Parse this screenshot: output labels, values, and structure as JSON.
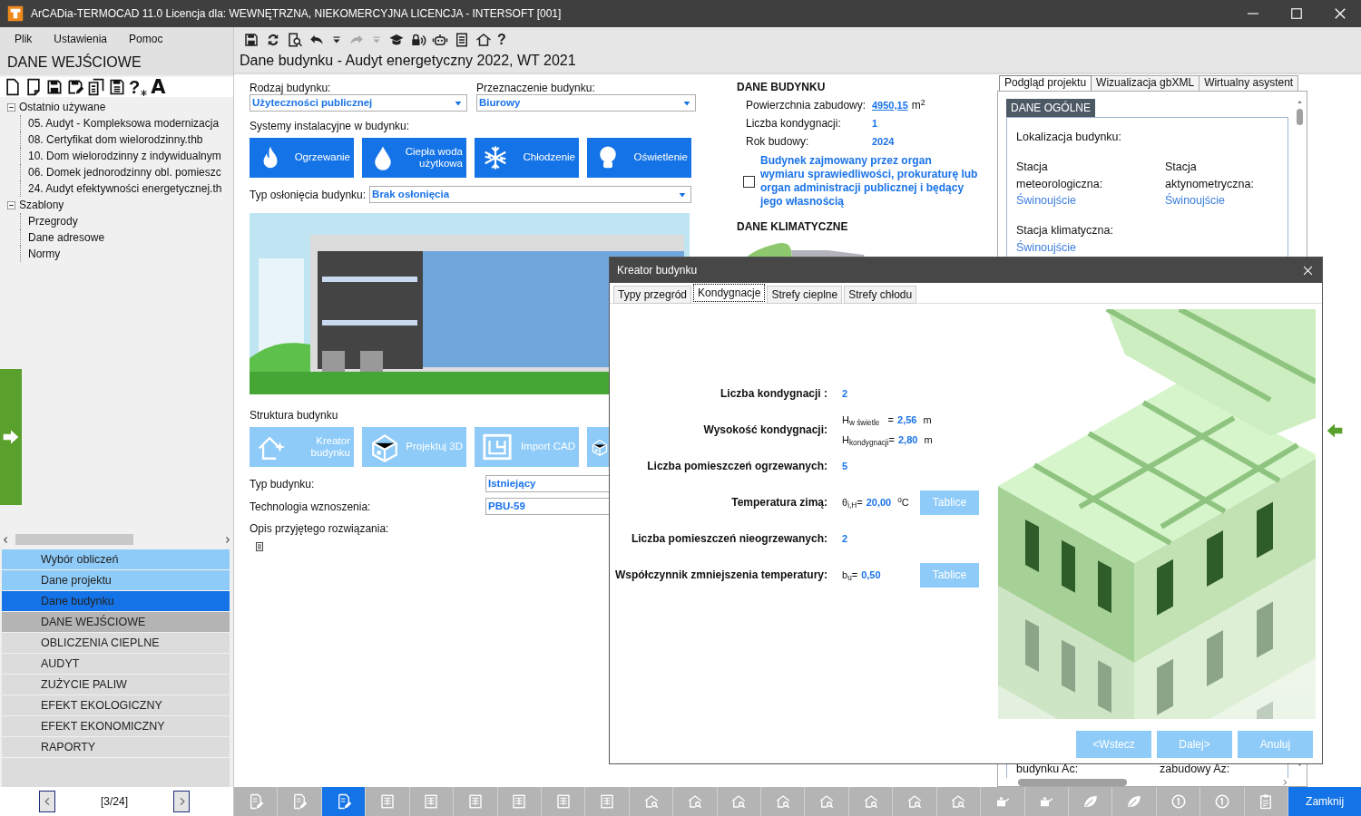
{
  "window": {
    "title": "ArCADia-TERMOCAD 11.0 Licencja dla: WEWNĘTRZNA, NIEKOMERCYJNA LICENCJA - INTERSOFT [001]"
  },
  "menu": [
    {
      "label": "Plik"
    },
    {
      "label": "Ustawienia"
    },
    {
      "label": "Pomoc"
    }
  ],
  "toolbar": [
    {
      "kind": "save",
      "disabled": false
    },
    {
      "kind": "sync",
      "disabled": false
    },
    {
      "kind": "preview",
      "disabled": false
    },
    {
      "kind": "undo",
      "disabled": false
    },
    {
      "kind": "menu-arrow",
      "disabled": false
    },
    {
      "kind": "redo",
      "disabled": true
    },
    {
      "kind": "menu-arrow",
      "disabled": true
    },
    {
      "kind": "cap",
      "disabled": false
    },
    {
      "kind": "lock",
      "disabled": false
    },
    {
      "kind": "robot",
      "disabled": false
    },
    {
      "kind": "notes",
      "disabled": false
    },
    {
      "kind": "house",
      "disabled": false
    },
    {
      "kind": "help",
      "glyph": "?",
      "disabled": false
    }
  ],
  "left_panel": {
    "title": "DANE WEJŚCIOWE",
    "toolbar": [
      {
        "kind": "new-doc"
      },
      {
        "kind": "new-doc-corner"
      },
      {
        "kind": "save"
      },
      {
        "kind": "save-edit"
      },
      {
        "kind": "copy-doc"
      },
      {
        "kind": "save-list"
      },
      {
        "kind": "help-star",
        "glyph": "?"
      },
      {
        "kind": "font",
        "glyph": "A"
      }
    ],
    "tree": [
      {
        "label": "Ostatnio używane",
        "expanded": true,
        "children": [
          {
            "label": "05. Audyt - Kompleksowa modernizacja"
          },
          {
            "label": "08. Certyfikat dom wielorodzinny.thb"
          },
          {
            "label": "10. Dom wielorodzinny z indywidualnym"
          },
          {
            "label": "06. Domek jednorodzinny obl. pomieszc"
          },
          {
            "label": "24. Audyt efektywności energetycznej.th"
          }
        ]
      },
      {
        "label": "Szablony",
        "expanded": true,
        "children": [
          {
            "label": "Przegrody"
          },
          {
            "label": "Dane adresowe"
          },
          {
            "label": "Normy"
          }
        ]
      }
    ],
    "nav": [
      {
        "label": "Wybór obliczeń",
        "kind": "step",
        "selected": false
      },
      {
        "label": "Dane projektu",
        "kind": "step",
        "selected": false
      },
      {
        "label": "Dane budynku",
        "kind": "step",
        "selected": true
      },
      {
        "label": "DANE WEJŚCIOWE",
        "kind": "section",
        "selected": true
      },
      {
        "label": "OBLICZENIA CIEPLNE",
        "kind": "section",
        "selected": false
      },
      {
        "label": "AUDYT",
        "kind": "section",
        "selected": false
      },
      {
        "label": "ZUŻYCIE PALIW",
        "kind": "section",
        "selected": false
      },
      {
        "label": "EFEKT EKOLOGICZNY",
        "kind": "section",
        "selected": false
      },
      {
        "label": "EFEKT EKONOMICZNY",
        "kind": "section",
        "selected": false
      },
      {
        "label": "RAPORTY",
        "kind": "section",
        "selected": false
      }
    ],
    "pager": "[3/24]"
  },
  "main": {
    "title": "Dane budynku - Audyt energetyczny 2022, WT 2021",
    "building_type": {
      "label": "Rodzaj budynku:",
      "value": "Użyteczności publicznej"
    },
    "purpose": {
      "label": "Przeznaczenie budynku:",
      "value": "Biurowy"
    },
    "systems_label": "Systemy instalacyjne w budynku:",
    "systems": [
      {
        "label": "Ogrzewanie",
        "kind": "flame"
      },
      {
        "label": "Ciepła woda użytkowa",
        "kind": "drop"
      },
      {
        "label": "Chłodzenie",
        "kind": "snow"
      },
      {
        "label": "Oświetlenie",
        "kind": "bulb"
      }
    ],
    "shading": {
      "label": "Typ osłonięcia budynku:",
      "value": "Brak osłonięcia"
    },
    "structure_label": "Struktura budynku",
    "structure_buttons": [
      {
        "label": "Kreator budynku",
        "kind": "wizard"
      },
      {
        "label": "Projektuj 3D",
        "kind": "house3d"
      },
      {
        "label": "Import CAD",
        "kind": "plan"
      },
      {
        "kind": "house3d"
      }
    ],
    "building_kind": {
      "label": "Typ budynku:",
      "value": "Istniejący"
    },
    "technology": {
      "label": "Technologia wznoszenia:",
      "value": "PBU-59"
    },
    "description_label": "Opis przyjętego rozwiązania:"
  },
  "building_data": {
    "title": "DANE BUDYNKU",
    "rows": [
      {
        "label": "Powierzchnia zabudowy:",
        "value": "4950,15",
        "unit": "m$^{2}$",
        "link": true
      },
      {
        "label": "Liczba kondygnacji:",
        "value": "1",
        "link": false
      },
      {
        "label": "Rok budowy:",
        "value": "2024",
        "link": false
      }
    ],
    "public_authority": {
      "label": "Budynek zajmowany przez organ wymiaru sprawiedliwości, prokuraturę lub organ administracji publicznej i będący jego własnością",
      "checked": false
    },
    "climate_title": "DANE KLIMATYCZNE"
  },
  "preview": {
    "tabs": [
      {
        "label": "Podgląd projektu",
        "selected": true
      },
      {
        "label": "Wizualizacja gbXML",
        "selected": false
      },
      {
        "label": "Wirtualny asystent",
        "selected": false
      }
    ],
    "section": "DANE OGÓLNE",
    "location_label": "Lokalizacja budynku:",
    "stations": [
      {
        "label": "Stacja meteorologiczna:",
        "value": "Świnoujście"
      },
      {
        "label": "Stacja aktynometryczna:",
        "value": "Świnoujście"
      },
      {
        "label": "Stacja klimatyczna:",
        "value": "Świnoujście"
      }
    ],
    "bottom_texts": [
      "budynku Ac:",
      "zabudowy Az:"
    ]
  },
  "dialog": {
    "title": "Kreator budynku",
    "tabs": [
      {
        "label": "Typy przegród",
        "selected": false
      },
      {
        "label": "Kondygnacje",
        "selected": true
      },
      {
        "label": "Strefy cieplne",
        "selected": false
      },
      {
        "label": "Strefy chłodu",
        "selected": false
      }
    ],
    "fields": [
      {
        "label": "Liczba kondygnacji :",
        "parts": [
          {
            "value": "2"
          }
        ]
      },
      {
        "label": "Wysokość kondygnacji:",
        "parts": [
          {
            "symbol": "H$_{w świetle}$   =",
            "value": "2,56",
            "unit": "m"
          },
          {
            "symbol": "H$_{kondygnacji}$=",
            "value": "2,80",
            "unit": "m"
          }
        ]
      },
      {
        "label": "Liczba pomieszczeń ogrzewanych:",
        "parts": [
          {
            "value": "5"
          }
        ]
      },
      {
        "label": "Temperatura zimą:",
        "parts": [
          {
            "symbol": "θ$_{i,H}$=",
            "value": "20,00",
            "unit": "$^{o}$C"
          }
        ],
        "button": "Tablice"
      },
      {
        "label": "Liczba pomieszczeń nieogrzewanych:",
        "parts": [
          {
            "value": "2"
          }
        ]
      },
      {
        "label": "Współczynnik zmniejszenia temperatury:",
        "parts": [
          {
            "symbol": "b$_{u}$=",
            "value": "0,50"
          }
        ],
        "button": "Tablice"
      }
    ],
    "buttons": [
      {
        "label": "<Wstecz"
      },
      {
        "label": "Dalej>"
      },
      {
        "label": "Anuluj"
      }
    ]
  },
  "bottom_toolbar": [
    {
      "kind": "doc-edit",
      "selected": false
    },
    {
      "kind": "doc-edit",
      "selected": false
    },
    {
      "kind": "doc-edit",
      "selected": true
    },
    {
      "kind": "table",
      "selected": false
    },
    {
      "kind": "table",
      "selected": false
    },
    {
      "kind": "table",
      "selected": false
    },
    {
      "kind": "table",
      "selected": false
    },
    {
      "kind": "table",
      "selected": false
    },
    {
      "kind": "table",
      "selected": false
    },
    {
      "kind": "house-search",
      "selected": false
    },
    {
      "kind": "house-search",
      "selected": false
    },
    {
      "kind": "house-search",
      "selected": false
    },
    {
      "kind": "house-search",
      "selected": false
    },
    {
      "kind": "house-search",
      "selected": false
    },
    {
      "kind": "house-search",
      "selected": false
    },
    {
      "kind": "house-search",
      "selected": false
    },
    {
      "kind": "house-search",
      "selected": false
    },
    {
      "kind": "kettle",
      "selected": false
    },
    {
      "kind": "kettle",
      "selected": false
    },
    {
      "kind": "leaf",
      "selected": false
    },
    {
      "kind": "leaf",
      "selected": false
    },
    {
      "kind": "coin",
      "selected": false
    },
    {
      "kind": "coin",
      "selected": false
    },
    {
      "kind": "clipboard",
      "selected": false
    }
  ],
  "close_label": "Zamknij"
}
